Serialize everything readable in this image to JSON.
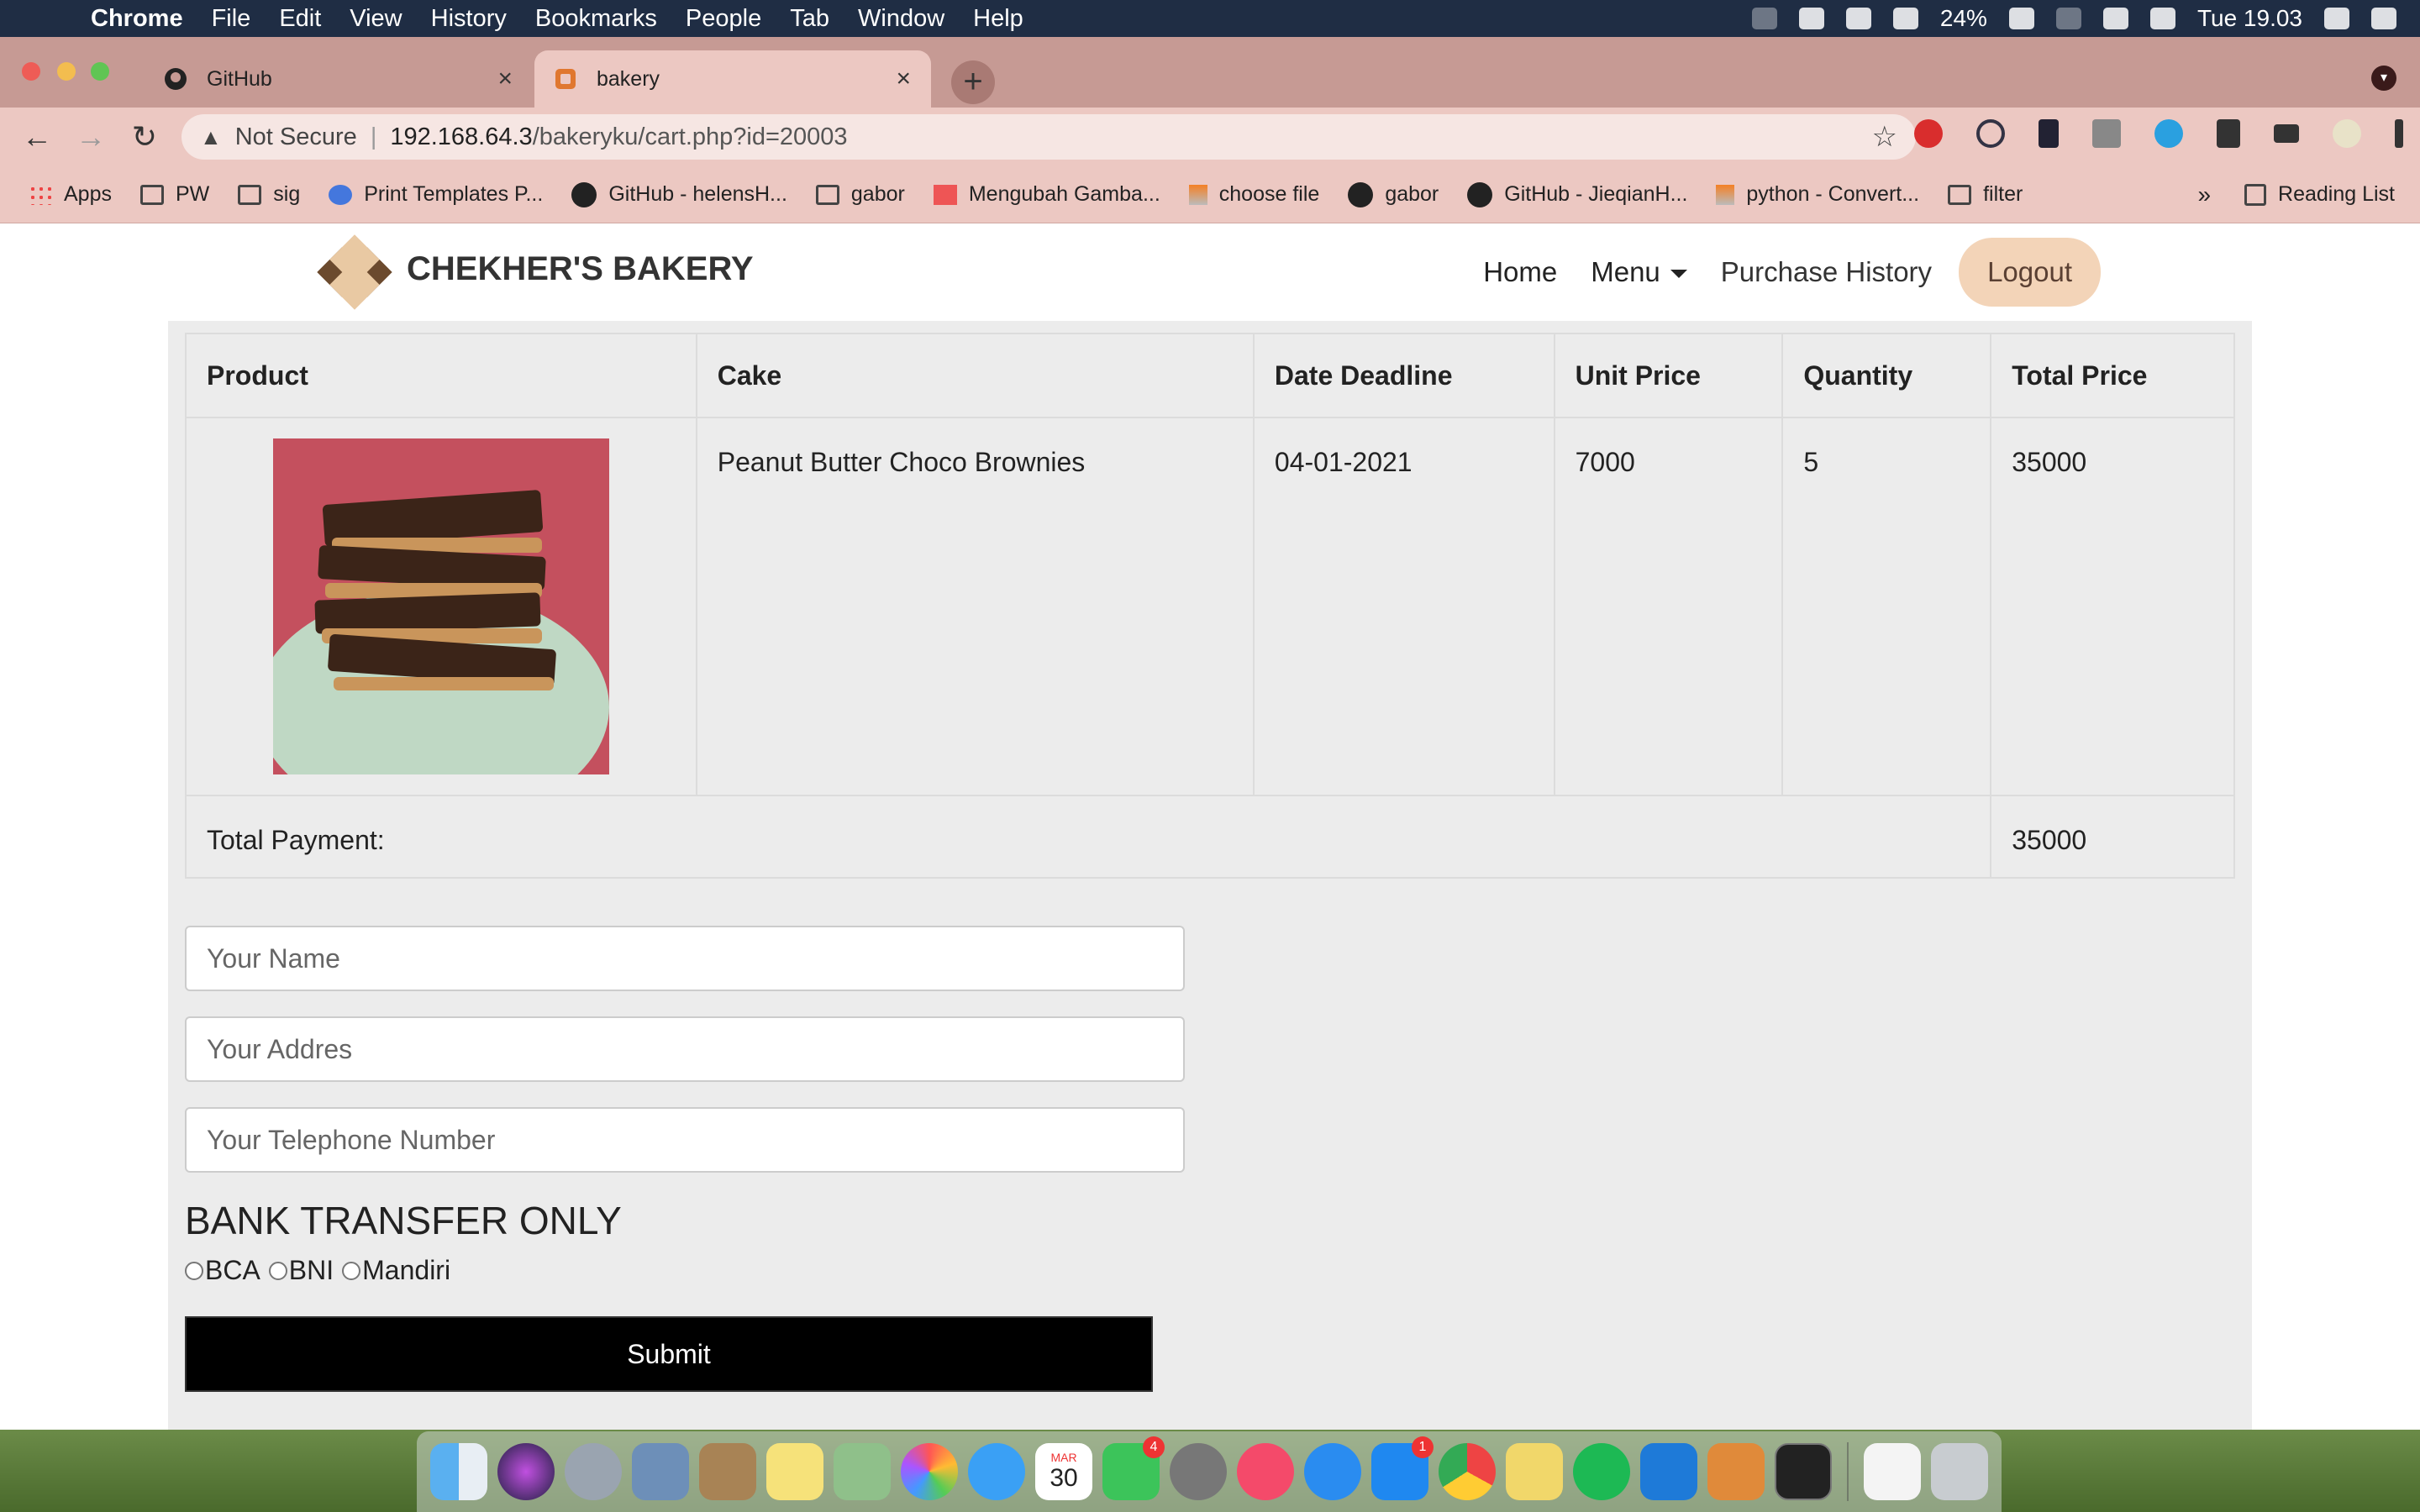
{
  "menubar": {
    "app": "Chrome",
    "items": [
      "File",
      "Edit",
      "View",
      "History",
      "Bookmarks",
      "People",
      "Tab",
      "Window",
      "Help"
    ],
    "battery": "24%",
    "clock": "Tue 19.03"
  },
  "tabs": [
    {
      "title": "GitHub",
      "icon": "github-icon"
    },
    {
      "title": "bakery",
      "icon": "xampp-icon"
    }
  ],
  "omnibox": {
    "security": "Not Secure",
    "host": "192.168.64.3",
    "path": "/bakeryku/cart.php?id=20003"
  },
  "bookmarks": [
    {
      "label": "Apps",
      "icon": "apps-grid-icon"
    },
    {
      "label": "PW",
      "icon": "folder-icon"
    },
    {
      "label": "sig",
      "icon": "folder-icon"
    },
    {
      "label": "Print Templates P...",
      "icon": "template-icon"
    },
    {
      "label": "GitHub - helensH...",
      "icon": "github-icon"
    },
    {
      "label": "gabor",
      "icon": "folder-icon"
    },
    {
      "label": "Mengubah Gamba...",
      "icon": "image-icon"
    },
    {
      "label": "choose file",
      "icon": "stackoverflow-icon"
    },
    {
      "label": "gabor",
      "icon": "github-icon"
    },
    {
      "label": "GitHub - JieqianH...",
      "icon": "github-icon"
    },
    {
      "label": "python - Convert...",
      "icon": "stackoverflow-icon"
    },
    {
      "label": "filter",
      "icon": "folder-icon"
    }
  ],
  "bookmarks_more": "»",
  "reading_list": "Reading List",
  "site": {
    "brand": "CHEKHER'S BAKERY",
    "nav": {
      "home": "Home",
      "menu": "Menu",
      "history": "Purchase History",
      "logout": "Logout"
    }
  },
  "cart": {
    "headers": [
      "Product",
      "Cake",
      "Date Deadline",
      "Unit Price",
      "Quantity",
      "Total Price"
    ],
    "row": {
      "cake": "Peanut Butter Choco Brownies",
      "deadline": "04-01-2021",
      "unit_price": "7000",
      "quantity": "5",
      "total_price": "35000"
    },
    "total_label": "Total Payment:",
    "total_value": "35000"
  },
  "form": {
    "name_placeholder": "Your Name",
    "address_placeholder": "Your Addres",
    "phone_placeholder": "Your Telephone Number",
    "bank_title": "BANK TRANSFER ONLY",
    "banks": [
      "BCA",
      "BNI",
      "Mandiri"
    ],
    "submit": "Submit"
  },
  "dock": {
    "calendar_month": "MAR",
    "calendar_day": "30",
    "facetime_badge": "4",
    "appstore_badge": "1"
  }
}
